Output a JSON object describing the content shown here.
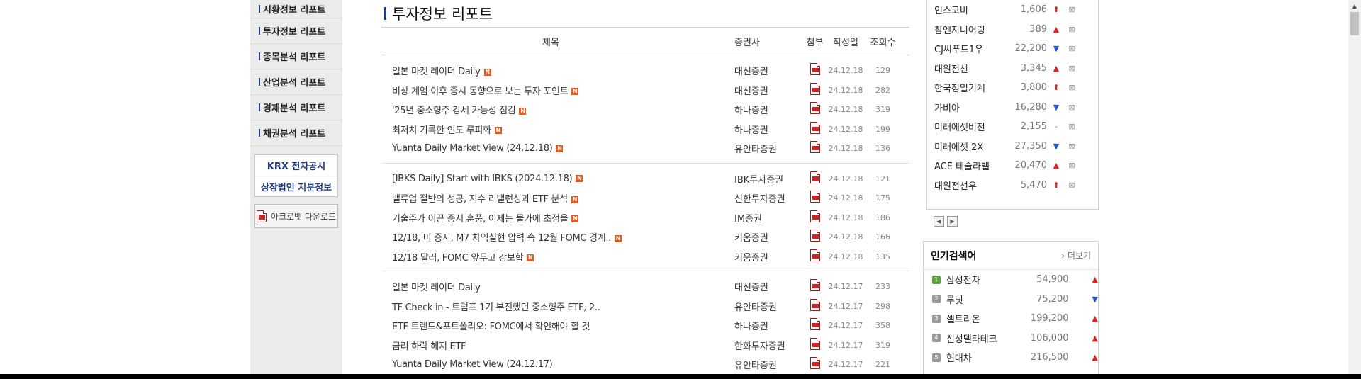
{
  "sidebar": {
    "menu": [
      "시황정보 리포트",
      "투자정보 리포트",
      "종목분석 리포트",
      "산업분석 리포트",
      "경제분석 리포트",
      "채권분석 리포트"
    ],
    "box_links": [
      "KRX 전자공시",
      "상장법인 지분정보"
    ],
    "acrobat_label": "아크로뱃 다운로드"
  },
  "main": {
    "title": "투자정보 리포트",
    "headers": {
      "title": "제목",
      "broker": "증권사",
      "attach": "첨부",
      "date": "작성일",
      "views": "조회수"
    },
    "new_badge": "N",
    "groups": [
      [
        {
          "title": "일본 마켓 레이더 Daily",
          "new": true,
          "broker": "대신증권",
          "date": "24.12.18",
          "views": "129"
        },
        {
          "title": "비상 계엄 이후 증시 동향으로 보는 투자 포인트",
          "new": true,
          "broker": "대신증권",
          "date": "24.12.18",
          "views": "282"
        },
        {
          "title": "'25년 중소형주 강세 가능성 점검",
          "new": true,
          "broker": "하나증권",
          "date": "24.12.18",
          "views": "319"
        },
        {
          "title": "최저치 기록한 인도 루피화",
          "new": true,
          "broker": "하나증권",
          "date": "24.12.18",
          "views": "199"
        },
        {
          "title": "Yuanta Daily Market View (24.12.18)",
          "new": true,
          "broker": "유안타증권",
          "date": "24.12.18",
          "views": "136"
        }
      ],
      [
        {
          "title": "[IBKS Daily] Start with IBKS (2024.12.18)",
          "new": true,
          "broker": "IBK투자증권",
          "date": "24.12.18",
          "views": "121"
        },
        {
          "title": "밸류업 절반의 성공, 지수 리밸런싱과 ETF 분석",
          "new": true,
          "broker": "신한투자증권",
          "date": "24.12.18",
          "views": "175"
        },
        {
          "title": "기술주가 이끈 증시 훈풍, 이제는 물가에 초점을",
          "new": true,
          "broker": "IM증권",
          "date": "24.12.18",
          "views": "186"
        },
        {
          "title": "12/18, 미 증시, M7 차익실현 압력 속 12월 FOMC 경계..",
          "new": true,
          "broker": "키움증권",
          "date": "24.12.18",
          "views": "166"
        },
        {
          "title": "12/18 달러, FOMC 앞두고 강보합",
          "new": true,
          "broker": "키움증권",
          "date": "24.12.18",
          "views": "135"
        }
      ],
      [
        {
          "title": "일본 마켓 레이더 Daily",
          "new": false,
          "broker": "대신증권",
          "date": "24.12.17",
          "views": "233"
        },
        {
          "title": "TF Check in - 트럼프 1기 부진했던 중소형주 ETF, 2..",
          "new": false,
          "broker": "유안타증권",
          "date": "24.12.17",
          "views": "298"
        },
        {
          "title": "ETF 트렌드&포트폴리오: FOMC에서 확인해야 할 것",
          "new": false,
          "broker": "하나증권",
          "date": "24.12.17",
          "views": "358"
        },
        {
          "title": "금리 하락 헤지 ETF",
          "new": false,
          "broker": "한화투자증권",
          "date": "24.12.17",
          "views": "319"
        },
        {
          "title": "Yuanta Daily Market View (24.12.17)",
          "new": false,
          "broker": "유안타증권",
          "date": "24.12.17",
          "views": "221"
        }
      ]
    ]
  },
  "stocks": {
    "del_glyph": "⊠",
    "items": [
      {
        "name": "인스코비",
        "price": "1,606",
        "dir": "⬆",
        "trend": "up"
      },
      {
        "name": "참엔지니어링",
        "price": "389",
        "dir": "▲",
        "trend": "up"
      },
      {
        "name": "CJ씨푸드1우",
        "price": "22,200",
        "dir": "▼",
        "trend": "down"
      },
      {
        "name": "대원전선",
        "price": "3,345",
        "dir": "▲",
        "trend": "up"
      },
      {
        "name": "한국정밀기계",
        "price": "3,800",
        "dir": "⬆",
        "trend": "up"
      },
      {
        "name": "가비아",
        "price": "16,280",
        "dir": "▼",
        "trend": "down"
      },
      {
        "name": "미래에셋비전",
        "price": "2,155",
        "dir": "-",
        "trend": "flat"
      },
      {
        "name": "미래에셋 2X",
        "price": "27,350",
        "dir": "▼",
        "trend": "down"
      },
      {
        "name": "ACE 테슬라밸",
        "price": "20,470",
        "dir": "▲",
        "trend": "up"
      },
      {
        "name": "대원전선우",
        "price": "5,470",
        "dir": "⬆",
        "trend": "up"
      }
    ],
    "pager": [
      "◀",
      "▶"
    ]
  },
  "popular": {
    "title": "인기검색어",
    "more": "› 더보기",
    "items": [
      {
        "rank": "1",
        "name": "삼성전자",
        "price": "54,900",
        "dir": "▲",
        "trend": "up"
      },
      {
        "rank": "2",
        "name": "루닛",
        "price": "75,200",
        "dir": "▼",
        "trend": "down"
      },
      {
        "rank": "3",
        "name": "셀트리온",
        "price": "199,200",
        "dir": "▲",
        "trend": "up"
      },
      {
        "rank": "4",
        "name": "신성델타테크",
        "price": "106,000",
        "dir": "▲",
        "trend": "up"
      },
      {
        "rank": "5",
        "name": "현대차",
        "price": "216,500",
        "dir": "▲",
        "trend": "up"
      }
    ]
  },
  "colors": {
    "accent": "#1a3f8f",
    "up": "#dd2222",
    "down": "#2255cc",
    "new_badge": "#e8591a"
  }
}
